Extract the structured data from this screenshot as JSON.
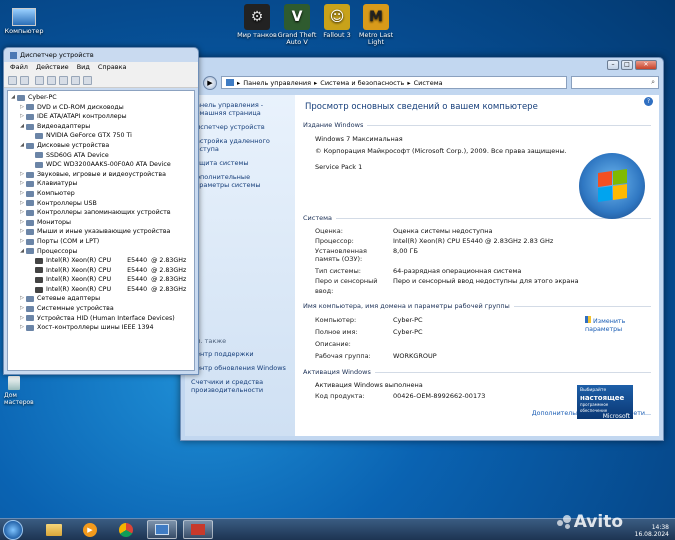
{
  "desktop": {
    "icons": [
      {
        "label": "Компьютер",
        "icon": "computer-icon"
      },
      {
        "label": "Мир танков",
        "icon": "tanks-icon",
        "color": "#222222"
      },
      {
        "label": "Grand Theft Auto V",
        "icon": "gta-icon",
        "color": "#2f5b2f"
      },
      {
        "label": "Fallout 3",
        "icon": "fallout-icon",
        "color": "#c8a21a"
      },
      {
        "label": "Metro Last Light",
        "icon": "metro-icon",
        "color": "#d89a1a"
      },
      {
        "label": "Дом мастеров",
        "icon": "recycle-bin-icon"
      }
    ]
  },
  "devmgr": {
    "title": "Диспетчер устройств",
    "menu": [
      "Файл",
      "Действие",
      "Вид",
      "Справка"
    ],
    "tree": [
      {
        "label": "Cyber-PC",
        "level": 0,
        "expander": "◢"
      },
      {
        "label": "DVD и CD-ROM дисководы",
        "level": 1,
        "expander": "▷"
      },
      {
        "label": "IDE ATA/ATAPI контроллеры",
        "level": 1,
        "expander": "▷"
      },
      {
        "label": "Видеоадаптеры",
        "level": 1,
        "expander": "◢"
      },
      {
        "label": "NVIDIA GeForce GTX 750 Ti",
        "level": 2,
        "expander": ""
      },
      {
        "label": "Дисковые устройства",
        "level": 1,
        "expander": "◢"
      },
      {
        "label": "SSD60G ATA Device",
        "level": 2,
        "expander": ""
      },
      {
        "label": "WDC WD3200AAKS-00F0A0 ATA Device",
        "level": 2,
        "expander": ""
      },
      {
        "label": "Звуковые, игровые и видеоустройства",
        "level": 1,
        "expander": "▷"
      },
      {
        "label": "Клавиатуры",
        "level": 1,
        "expander": "▷"
      },
      {
        "label": "Компьютер",
        "level": 1,
        "expander": "▷"
      },
      {
        "label": "Контроллеры USB",
        "level": 1,
        "expander": "▷"
      },
      {
        "label": "Контроллеры запоминающих устройств",
        "level": 1,
        "expander": "▷"
      },
      {
        "label": "Мониторы",
        "level": 1,
        "expander": "▷"
      },
      {
        "label": "Мыши и иные указывающие устройства",
        "level": 1,
        "expander": "▷"
      },
      {
        "label": "Порты (COM и LPT)",
        "level": 1,
        "expander": "▷"
      },
      {
        "label": "Процессоры",
        "level": 1,
        "expander": "◢"
      },
      {
        "label": "Intel(R) Xeon(R) CPU        E5440  @ 2.83GHz",
        "level": 2,
        "expander": "",
        "cpu": true
      },
      {
        "label": "Intel(R) Xeon(R) CPU        E5440  @ 2.83GHz",
        "level": 2,
        "expander": "",
        "cpu": true
      },
      {
        "label": "Intel(R) Xeon(R) CPU        E5440  @ 2.83GHz",
        "level": 2,
        "expander": "",
        "cpu": true
      },
      {
        "label": "Intel(R) Xeon(R) CPU        E5440  @ 2.83GHz",
        "level": 2,
        "expander": "",
        "cpu": true
      },
      {
        "label": "Сетевые адаптеры",
        "level": 1,
        "expander": "▷"
      },
      {
        "label": "Системные устройства",
        "level": 1,
        "expander": "▷"
      },
      {
        "label": "Устройства HID (Human Interface Devices)",
        "level": 1,
        "expander": "▷"
      },
      {
        "label": "Хост-контроллеры шины IEEE 1394",
        "level": 1,
        "expander": "▷"
      }
    ]
  },
  "system": {
    "breadcrumb": [
      "Панель управления",
      "Система и безопасность",
      "Система"
    ],
    "sidebar": {
      "home": "Панель управления - домашняя страница",
      "links": [
        "Диспетчер устройств",
        "Настройка удаленного доступа",
        "Защита системы",
        "Дополнительные параметры системы"
      ],
      "see_also": "См. также",
      "see_links": [
        "Центр поддержки",
        "Центр обновления Windows",
        "Счетчики и средства производительности"
      ]
    },
    "heading": "Просмотр основных сведений о вашем компьютере",
    "edition": {
      "header": "Издание Windows",
      "name": "Windows 7 Максимальная",
      "copyright": "© Корпорация Майкрософт (Microsoft Corp.), 2009. Все права защищены.",
      "sp": "Service Pack 1"
    },
    "sys": {
      "header": "Система",
      "rows": [
        {
          "k": "Оценка:",
          "v": "Оценка системы недоступна",
          "link": true
        },
        {
          "k": "Процессор:",
          "v": "Intel(R) Xeon(R) CPU        E5440  @ 2.83GHz   2.83 GHz"
        },
        {
          "k": "Установленная память (ОЗУ):",
          "v": "8,00 ГБ"
        },
        {
          "k": "Тип системы:",
          "v": "64-разрядная операционная система"
        },
        {
          "k": "Перо и сенсорный ввод:",
          "v": "Перо и сенсорный ввод недоступны для этого экрана"
        }
      ]
    },
    "comp": {
      "header": "Имя компьютера, имя домена и параметры рабочей группы",
      "change": "Изменить параметры",
      "rows": [
        {
          "k": "Компьютер:",
          "v": "Cyber-PC"
        },
        {
          "k": "Полное имя:",
          "v": "Cyber-PC"
        },
        {
          "k": "Описание:",
          "v": ""
        },
        {
          "k": "Рабочая группа:",
          "v": "WORKGROUP"
        }
      ]
    },
    "activation": {
      "header": "Активация Windows",
      "status": "Активация Windows выполнена",
      "key_label": "Код продукта:",
      "key": "00426-OEM-8992662-00173",
      "badge_line1": "Выбирайте",
      "badge_line2": "настоящее",
      "badge_line3": "программное обеспечение",
      "badge_line4": "Microsoft",
      "more": "Дополнительные сведения в сети..."
    }
  },
  "taskbar": {
    "time": "14:38",
    "date": "16.08.2024",
    "watermark": "Avito"
  }
}
